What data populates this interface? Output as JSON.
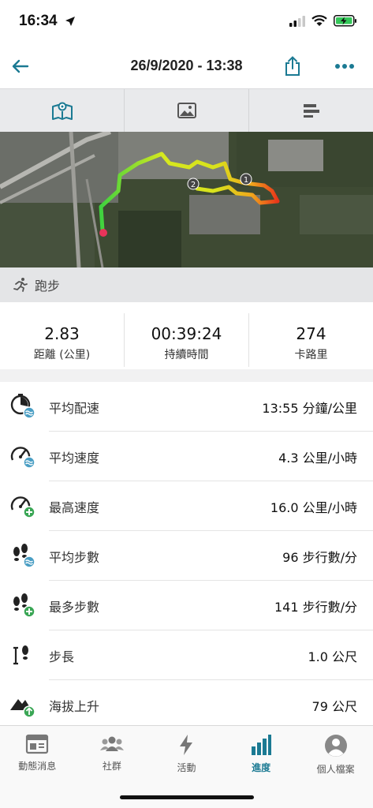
{
  "status": {
    "time": "16:34"
  },
  "nav": {
    "title": "26/9/2020 - 13:38"
  },
  "tabs": [
    {
      "icon": "map-icon",
      "active": true
    },
    {
      "icon": "image-icon",
      "active": false
    },
    {
      "icon": "chart-icon",
      "active": false
    }
  ],
  "map": {
    "markers": [
      "1",
      "2"
    ]
  },
  "activity_type": "跑步",
  "summary": [
    {
      "value": "2.83",
      "label": "距離 (公里)"
    },
    {
      "value": "00:39:24",
      "label": "持續時間"
    },
    {
      "value": "274",
      "label": "卡路里"
    }
  ],
  "stats": [
    {
      "icon": "avg-pace-icon",
      "label": "平均配速",
      "value": "13:55 分鐘/公里"
    },
    {
      "icon": "avg-speed-icon",
      "label": "平均速度",
      "value": "4.3 公里/小時"
    },
    {
      "icon": "max-speed-icon",
      "label": "最高速度",
      "value": "16.0 公里/小時"
    },
    {
      "icon": "avg-cadence-icon",
      "label": "平均步數",
      "value": "96 步行數/分"
    },
    {
      "icon": "max-cadence-icon",
      "label": "最多步數",
      "value": "141 步行數/分"
    },
    {
      "icon": "stride-length-icon",
      "label": "步長",
      "value": "1.0 公尺"
    },
    {
      "icon": "elevation-gain-icon",
      "label": "海拔上升",
      "value": "79 公尺"
    }
  ],
  "bottom_nav": [
    {
      "icon": "news-feed-icon",
      "label": "動態消息"
    },
    {
      "icon": "community-icon",
      "label": "社群"
    },
    {
      "icon": "activity-icon",
      "label": "活動"
    },
    {
      "icon": "progress-icon",
      "label": "進度"
    },
    {
      "icon": "profile-icon",
      "label": "個人檔案"
    }
  ],
  "colors": {
    "accent": "#1b7a93",
    "secondary_badge": "#4a9ec4",
    "plus_badge": "#3aa655"
  }
}
